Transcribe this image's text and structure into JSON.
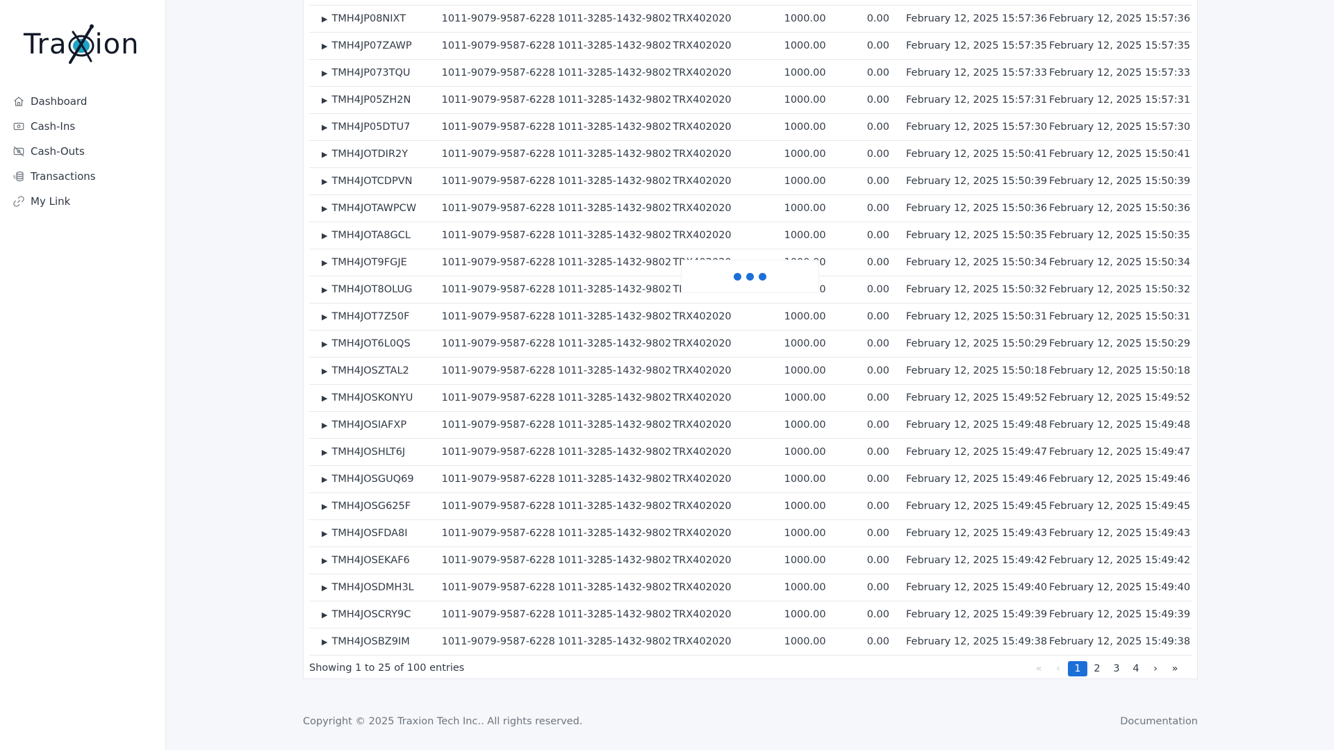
{
  "brand": {
    "logo_text_left": "Tra",
    "logo_text_right": "ion"
  },
  "colors": {
    "accent": "#1d6fd8",
    "logo_eye": "#1ea3c7"
  },
  "sidebar": {
    "items": [
      {
        "label": "Dashboard",
        "icon": "home-icon"
      },
      {
        "label": "Cash-Ins",
        "icon": "cash-icon"
      },
      {
        "label": "Cash-Outs",
        "icon": "cash-off-icon"
      },
      {
        "label": "Transactions",
        "icon": "coins-icon"
      },
      {
        "label": "My Link",
        "icon": "link-icon"
      }
    ]
  },
  "table": {
    "rows": [
      [
        "TMH4JP08NIXT",
        "1011-9079-9587-6228",
        "1011-3285-1432-9802",
        "TRX402020",
        "1000.00",
        "0.00",
        "February 12, 2025 15:57:36",
        "February 12, 2025 15:57:36"
      ],
      [
        "TMH4JP07ZAWP",
        "1011-9079-9587-6228",
        "1011-3285-1432-9802",
        "TRX402020",
        "1000.00",
        "0.00",
        "February 12, 2025 15:57:35",
        "February 12, 2025 15:57:35"
      ],
      [
        "TMH4JP073TQU",
        "1011-9079-9587-6228",
        "1011-3285-1432-9802",
        "TRX402020",
        "1000.00",
        "0.00",
        "February 12, 2025 15:57:33",
        "February 12, 2025 15:57:33"
      ],
      [
        "TMH4JP05ZH2N",
        "1011-9079-9587-6228",
        "1011-3285-1432-9802",
        "TRX402020",
        "1000.00",
        "0.00",
        "February 12, 2025 15:57:31",
        "February 12, 2025 15:57:31"
      ],
      [
        "TMH4JP05DTU7",
        "1011-9079-9587-6228",
        "1011-3285-1432-9802",
        "TRX402020",
        "1000.00",
        "0.00",
        "February 12, 2025 15:57:30",
        "February 12, 2025 15:57:30"
      ],
      [
        "TMH4JOTDIR2Y",
        "1011-9079-9587-6228",
        "1011-3285-1432-9802",
        "TRX402020",
        "1000.00",
        "0.00",
        "February 12, 2025 15:50:41",
        "February 12, 2025 15:50:41"
      ],
      [
        "TMH4JOTCDPVN",
        "1011-9079-9587-6228",
        "1011-3285-1432-9802",
        "TRX402020",
        "1000.00",
        "0.00",
        "February 12, 2025 15:50:39",
        "February 12, 2025 15:50:39"
      ],
      [
        "TMH4JOTAWPCW",
        "1011-9079-9587-6228",
        "1011-3285-1432-9802",
        "TRX402020",
        "1000.00",
        "0.00",
        "February 12, 2025 15:50:36",
        "February 12, 2025 15:50:36"
      ],
      [
        "TMH4JOTA8GCL",
        "1011-9079-9587-6228",
        "1011-3285-1432-9802",
        "TRX402020",
        "1000.00",
        "0.00",
        "February 12, 2025 15:50:35",
        "February 12, 2025 15:50:35"
      ],
      [
        "TMH4JOT9FGJE",
        "1011-9079-9587-6228",
        "1011-3285-1432-9802",
        "TRX402020",
        "1000.00",
        "0.00",
        "February 12, 2025 15:50:34",
        "February 12, 2025 15:50:34"
      ],
      [
        "TMH4JOT8OLUG",
        "1011-9079-9587-6228",
        "1011-3285-1432-9802",
        "TRX402020",
        "1000.00",
        "0.00",
        "February 12, 2025 15:50:32",
        "February 12, 2025 15:50:32"
      ],
      [
        "TMH4JOT7Z50F",
        "1011-9079-9587-6228",
        "1011-3285-1432-9802",
        "TRX402020",
        "1000.00",
        "0.00",
        "February 12, 2025 15:50:31",
        "February 12, 2025 15:50:31"
      ],
      [
        "TMH4JOT6L0QS",
        "1011-9079-9587-6228",
        "1011-3285-1432-9802",
        "TRX402020",
        "1000.00",
        "0.00",
        "February 12, 2025 15:50:29",
        "February 12, 2025 15:50:29"
      ],
      [
        "TMH4JOSZTAL2",
        "1011-9079-9587-6228",
        "1011-3285-1432-9802",
        "TRX402020",
        "1000.00",
        "0.00",
        "February 12, 2025 15:50:18",
        "February 12, 2025 15:50:18"
      ],
      [
        "TMH4JOSKONYU",
        "1011-9079-9587-6228",
        "1011-3285-1432-9802",
        "TRX402020",
        "1000.00",
        "0.00",
        "February 12, 2025 15:49:52",
        "February 12, 2025 15:49:52"
      ],
      [
        "TMH4JOSIAFXP",
        "1011-9079-9587-6228",
        "1011-3285-1432-9802",
        "TRX402020",
        "1000.00",
        "0.00",
        "February 12, 2025 15:49:48",
        "February 12, 2025 15:49:48"
      ],
      [
        "TMH4JOSHLT6J",
        "1011-9079-9587-6228",
        "1011-3285-1432-9802",
        "TRX402020",
        "1000.00",
        "0.00",
        "February 12, 2025 15:49:47",
        "February 12, 2025 15:49:47"
      ],
      [
        "TMH4JOSGUQ69",
        "1011-9079-9587-6228",
        "1011-3285-1432-9802",
        "TRX402020",
        "1000.00",
        "0.00",
        "February 12, 2025 15:49:46",
        "February 12, 2025 15:49:46"
      ],
      [
        "TMH4JOSG625F",
        "1011-9079-9587-6228",
        "1011-3285-1432-9802",
        "TRX402020",
        "1000.00",
        "0.00",
        "February 12, 2025 15:49:45",
        "February 12, 2025 15:49:45"
      ],
      [
        "TMH4JOSFDA8I",
        "1011-9079-9587-6228",
        "1011-3285-1432-9802",
        "TRX402020",
        "1000.00",
        "0.00",
        "February 12, 2025 15:49:43",
        "February 12, 2025 15:49:43"
      ],
      [
        "TMH4JOSEKAF6",
        "1011-9079-9587-6228",
        "1011-3285-1432-9802",
        "TRX402020",
        "1000.00",
        "0.00",
        "February 12, 2025 15:49:42",
        "February 12, 2025 15:49:42"
      ],
      [
        "TMH4JOSDMH3L",
        "1011-9079-9587-6228",
        "1011-3285-1432-9802",
        "TRX402020",
        "1000.00",
        "0.00",
        "February 12, 2025 15:49:40",
        "February 12, 2025 15:49:40"
      ],
      [
        "TMH4JOSCRY9C",
        "1011-9079-9587-6228",
        "1011-3285-1432-9802",
        "TRX402020",
        "1000.00",
        "0.00",
        "February 12, 2025 15:49:39",
        "February 12, 2025 15:49:39"
      ],
      [
        "TMH4JOSBZ9IM",
        "1011-9079-9587-6228",
        "1011-3285-1432-9802",
        "TRX402020",
        "1000.00",
        "0.00",
        "February 12, 2025 15:49:38",
        "February 12, 2025 15:49:38"
      ]
    ],
    "expand_glyph": "▶"
  },
  "pagination": {
    "info": "Showing 1 to 25 of 100 entries",
    "first": "«",
    "prev": "‹",
    "next": "›",
    "last": "»",
    "pages": [
      "1",
      "2",
      "3",
      "4"
    ],
    "current_page": "1"
  },
  "footer": {
    "copyright": "Copyright © 2025 Traxion Tech Inc.. All rights reserved.",
    "documentation": "Documentation"
  },
  "loading": true
}
